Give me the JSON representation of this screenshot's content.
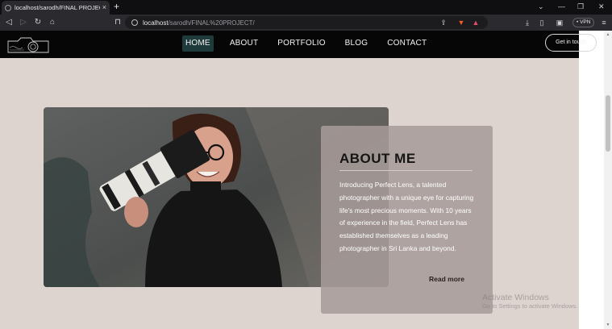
{
  "browser": {
    "tab_title": "localhost/sarodh/FINAL PROJECT",
    "tab_close": "×",
    "new_tab": "+",
    "url_host": "localhost",
    "url_path": "/sarodh/FINAL%20PROJECT/",
    "vpn_label": "• VPN",
    "icons": [
      "back-icon",
      "forward-icon",
      "reload-icon",
      "home-icon",
      "bookmark-icon",
      "share-icon",
      "brave-shield-icon",
      "brave-rewards-icon",
      "download-icon",
      "sidebar-icon",
      "wallet-icon",
      "menu-icon"
    ]
  },
  "site": {
    "nav": [
      {
        "label": "HOME",
        "active": true
      },
      {
        "label": "ABOUT",
        "active": false
      },
      {
        "label": "PORTFOLIO",
        "active": false
      },
      {
        "label": "BLOG",
        "active": false
      },
      {
        "label": "CONTACT",
        "active": false
      }
    ],
    "cta": "Get in touch",
    "about": {
      "title": "ABOUT ME",
      "body": "Introducing Perfect Lens, a talented photographer with a unique eye for capturing life's most precious moments. With 10 years of experience in the field, Perfect Lens has established themselves as a leading photographer in Sri Lanka and beyond.",
      "read_more": "Read more"
    },
    "colors": {
      "page_bg": "#ddd3cf",
      "nav_bg": "#060607",
      "active_nav": "#1e3a3a",
      "card_bg": "#a79b98"
    }
  },
  "os_watermark": {
    "line1": "Activate Windows",
    "line2": "Go to Settings to activate Windows."
  }
}
